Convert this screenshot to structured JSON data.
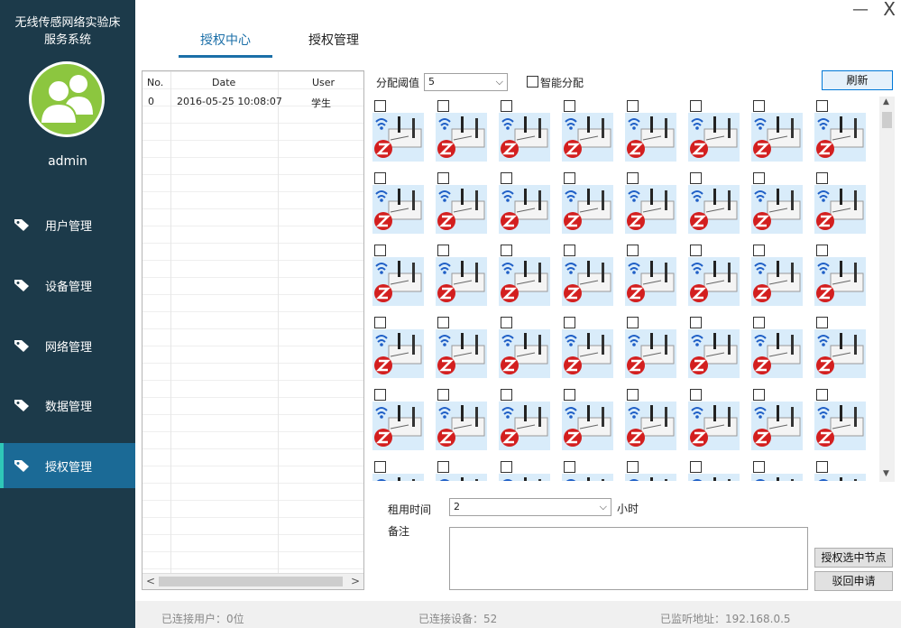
{
  "sidebar": {
    "title_line1": "无线传感网络实验床",
    "title_line2": "服务系统",
    "username": "admin",
    "items": [
      {
        "label": "用户管理",
        "active": false
      },
      {
        "label": "设备管理",
        "active": false
      },
      {
        "label": "网络管理",
        "active": false
      },
      {
        "label": "数据管理",
        "active": false
      },
      {
        "label": "授权管理",
        "active": true
      }
    ]
  },
  "window": {
    "minimize": "—",
    "close": "X"
  },
  "tabs": [
    {
      "label": "授权中心",
      "active": true
    },
    {
      "label": "授权管理",
      "active": false
    }
  ],
  "table": {
    "columns": [
      "No.",
      "Date",
      "User"
    ],
    "rows": [
      {
        "no": "0",
        "date": "2016-05-25 10:08:07",
        "user": "学生"
      }
    ]
  },
  "controls": {
    "threshold_label": "分配阈值",
    "threshold_value": "5",
    "smart_label": "智能分配",
    "refresh_label": "刷新",
    "rent_label": "租用时间",
    "rent_value": "2",
    "rent_unit": "小时",
    "remark_label": "备注",
    "authorize_label": "授权选中节点",
    "reject_label": "驳回申请"
  },
  "status": {
    "users": "已连接用户：0位",
    "devices": "已连接设备：52",
    "address": "已监听地址：192.168.0.5"
  },
  "colors": {
    "sidebar_bg": "#1c3a4a",
    "active_nav": "#1b6a96",
    "accent": "#1b6fa8",
    "avatar_bg": "#8cc63f"
  },
  "icons": {
    "nav": "tag-icon",
    "node": "zigbee-node-icon"
  }
}
